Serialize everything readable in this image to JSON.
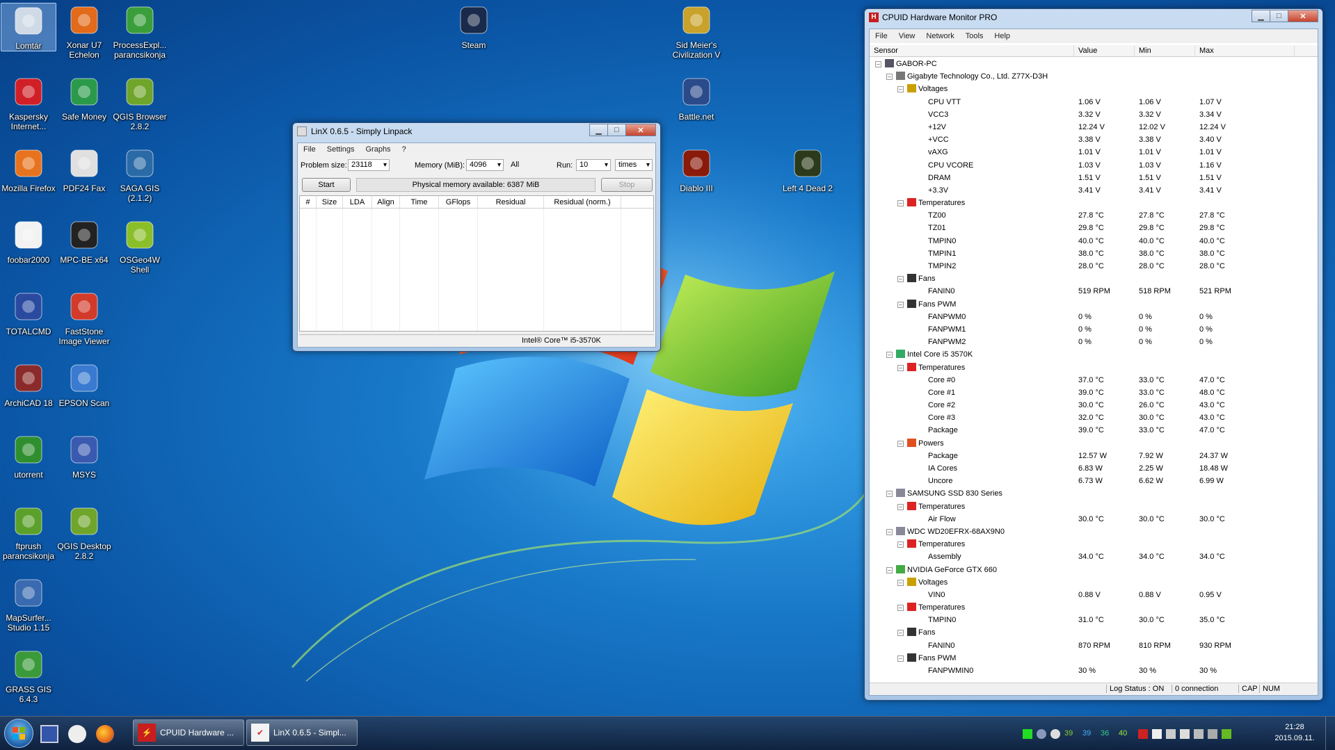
{
  "desktop_icons": [
    {
      "label": "Lomtár",
      "icon": "recycle-bin-icon"
    },
    {
      "label": "Xonar U7 Echelon",
      "icon": "equalizer-icon"
    },
    {
      "label": "ProcessExpl... parancsikonja",
      "icon": "process-explorer-icon"
    },
    {
      "label": "Kaspersky Internet...",
      "icon": "kaspersky-icon"
    },
    {
      "label": "Safe Money",
      "icon": "safe-money-icon"
    },
    {
      "label": "QGIS Browser 2.8.2",
      "icon": "qgis-icon"
    },
    {
      "label": "Mozilla Firefox",
      "icon": "firefox-icon"
    },
    {
      "label": "PDF24 Fax",
      "icon": "pdf24-icon"
    },
    {
      "label": "SAGA GIS (2.1.2)",
      "icon": "saga-gis-icon"
    },
    {
      "label": "foobar2000",
      "icon": "foobar-icon"
    },
    {
      "label": "MPC-BE x64",
      "icon": "mpc-be-icon"
    },
    {
      "label": "OSGeo4W Shell",
      "icon": "osgeo-icon"
    },
    {
      "label": "TOTALCMD",
      "icon": "floppy-icon"
    },
    {
      "label": "FastStone Image Viewer",
      "icon": "faststone-icon"
    },
    {
      "label": "ArchiCAD 18",
      "icon": "archicad-icon"
    },
    {
      "label": "EPSON Scan",
      "icon": "scanner-icon"
    },
    {
      "label": "utorrent",
      "icon": "utorrent-icon"
    },
    {
      "label": "MSYS",
      "icon": "msys-icon"
    },
    {
      "label": "ftprush parancsikonja",
      "icon": "ftprush-icon"
    },
    {
      "label": "QGIS Desktop 2.8.2",
      "icon": "qgis-desktop-icon"
    },
    {
      "label": "MapSurfer... Studio 1.15",
      "icon": "mapsurfer-icon"
    },
    {
      "label": "GRASS GIS 6.4.3",
      "icon": "grass-icon"
    },
    {
      "label": "Steam",
      "icon": "steam-icon"
    },
    {
      "label": "Sid Meier's Civilization V",
      "icon": "civilization-icon"
    },
    {
      "label": "Battle.net",
      "icon": "battlenet-icon"
    },
    {
      "label": "Diablo III",
      "icon": "diablo-icon"
    },
    {
      "label": "Left 4 Dead 2",
      "icon": "left4dead-icon"
    }
  ],
  "linx": {
    "title": "LinX 0.6.5 - Simply Linpack",
    "menu": [
      "File",
      "Settings",
      "Graphs",
      "?"
    ],
    "problem_size_label": "Problem size:",
    "problem_size": "23118",
    "memory_label": "Memory (MiB):",
    "memory": "4096",
    "all_label": "All",
    "run_label": "Run:",
    "run": "10",
    "run_unit": "times",
    "start": "Start",
    "phys_mem": "Physical memory available: 6387 MiB",
    "stop": "Stop",
    "columns": [
      "#",
      "Size",
      "LDA",
      "Align",
      "Time",
      "GFlops",
      "Residual",
      "Residual (norm.)"
    ],
    "status_cpu": "Intel® Core™ i5-3570K"
  },
  "hwmon": {
    "title": "CPUID Hardware Monitor PRO",
    "menu": [
      "File",
      "View",
      "Network",
      "Tools",
      "Help"
    ],
    "columns": [
      "Sensor",
      "Value",
      "Min",
      "Max"
    ],
    "rows": [
      {
        "level": 0,
        "name": "GABOR-PC",
        "type": "computer"
      },
      {
        "level": 1,
        "name": "Gigabyte Technology Co., Ltd. Z77X-D3H",
        "type": "board"
      },
      {
        "level": 2,
        "name": "Voltages",
        "type": "voltage"
      },
      {
        "level": 3,
        "name": "CPU VTT",
        "v": "1.06 V",
        "min": "1.06 V",
        "max": "1.07 V"
      },
      {
        "level": 3,
        "name": "VCC3",
        "v": "3.32 V",
        "min": "3.32 V",
        "max": "3.34 V"
      },
      {
        "level": 3,
        "name": "+12V",
        "v": "12.24 V",
        "min": "12.02 V",
        "max": "12.24 V"
      },
      {
        "level": 3,
        "name": "+VCC",
        "v": "3.38 V",
        "min": "3.38 V",
        "max": "3.40 V"
      },
      {
        "level": 3,
        "name": "vAXG",
        "v": "1.01 V",
        "min": "1.01 V",
        "max": "1.01 V"
      },
      {
        "level": 3,
        "name": "CPU VCORE",
        "v": "1.03 V",
        "min": "1.03 V",
        "max": "1.16 V"
      },
      {
        "level": 3,
        "name": "DRAM",
        "v": "1.51 V",
        "min": "1.51 V",
        "max": "1.51 V"
      },
      {
        "level": 3,
        "name": "+3.3V",
        "v": "3.41 V",
        "min": "3.41 V",
        "max": "3.41 V"
      },
      {
        "level": 2,
        "name": "Temperatures",
        "type": "temp"
      },
      {
        "level": 3,
        "name": "TZ00",
        "v": "27.8 °C",
        "min": "27.8 °C",
        "max": "27.8 °C"
      },
      {
        "level": 3,
        "name": "TZ01",
        "v": "29.8 °C",
        "min": "29.8 °C",
        "max": "29.8 °C"
      },
      {
        "level": 3,
        "name": "TMPIN0",
        "v": "40.0 °C",
        "min": "40.0 °C",
        "max": "40.0 °C"
      },
      {
        "level": 3,
        "name": "TMPIN1",
        "v": "38.0 °C",
        "min": "38.0 °C",
        "max": "38.0 °C"
      },
      {
        "level": 3,
        "name": "TMPIN2",
        "v": "28.0 °C",
        "min": "28.0 °C",
        "max": "28.0 °C"
      },
      {
        "level": 2,
        "name": "Fans",
        "type": "fan"
      },
      {
        "level": 3,
        "name": "FANIN0",
        "v": "519 RPM",
        "min": "518 RPM",
        "max": "521 RPM"
      },
      {
        "level": 2,
        "name": "Fans PWM",
        "type": "fan"
      },
      {
        "level": 3,
        "name": "FANPWM0",
        "v": "0 %",
        "min": "0 %",
        "max": "0 %"
      },
      {
        "level": 3,
        "name": "FANPWM1",
        "v": "0 %",
        "min": "0 %",
        "max": "0 %"
      },
      {
        "level": 3,
        "name": "FANPWM2",
        "v": "0 %",
        "min": "0 %",
        "max": "0 %"
      },
      {
        "level": 1,
        "name": "Intel Core i5 3570K",
        "type": "cpu"
      },
      {
        "level": 2,
        "name": "Temperatures",
        "type": "temp"
      },
      {
        "level": 3,
        "name": "Core #0",
        "v": "37.0 °C",
        "min": "33.0 °C",
        "max": "47.0 °C"
      },
      {
        "level": 3,
        "name": "Core #1",
        "v": "39.0 °C",
        "min": "33.0 °C",
        "max": "48.0 °C"
      },
      {
        "level": 3,
        "name": "Core #2",
        "v": "30.0 °C",
        "min": "26.0 °C",
        "max": "43.0 °C"
      },
      {
        "level": 3,
        "name": "Core #3",
        "v": "32.0 °C",
        "min": "30.0 °C",
        "max": "43.0 °C"
      },
      {
        "level": 3,
        "name": "Package",
        "v": "39.0 °C",
        "min": "33.0 °C",
        "max": "47.0 °C"
      },
      {
        "level": 2,
        "name": "Powers",
        "type": "power"
      },
      {
        "level": 3,
        "name": "Package",
        "v": "12.57 W",
        "min": "7.92 W",
        "max": "24.37 W"
      },
      {
        "level": 3,
        "name": "IA Cores",
        "v": "6.83 W",
        "min": "2.25 W",
        "max": "18.48 W"
      },
      {
        "level": 3,
        "name": "Uncore",
        "v": "6.73 W",
        "min": "6.62 W",
        "max": "6.99 W"
      },
      {
        "level": 1,
        "name": "SAMSUNG SSD 830 Series",
        "type": "disk"
      },
      {
        "level": 2,
        "name": "Temperatures",
        "type": "temp"
      },
      {
        "level": 3,
        "name": "Air Flow",
        "v": "30.0 °C",
        "min": "30.0 °C",
        "max": "30.0 °C"
      },
      {
        "level": 1,
        "name": "WDC WD20EFRX-68AX9N0",
        "type": "disk"
      },
      {
        "level": 2,
        "name": "Temperatures",
        "type": "temp"
      },
      {
        "level": 3,
        "name": "Assembly",
        "v": "34.0 °C",
        "min": "34.0 °C",
        "max": "34.0 °C"
      },
      {
        "level": 1,
        "name": "NVIDIA GeForce GTX 660",
        "type": "gpu"
      },
      {
        "level": 2,
        "name": "Voltages",
        "type": "voltage"
      },
      {
        "level": 3,
        "name": "VIN0",
        "v": "0.88 V",
        "min": "0.88 V",
        "max": "0.95 V"
      },
      {
        "level": 2,
        "name": "Temperatures",
        "type": "temp"
      },
      {
        "level": 3,
        "name": "TMPIN0",
        "v": "31.0 °C",
        "min": "30.0 °C",
        "max": "35.0 °C"
      },
      {
        "level": 2,
        "name": "Fans",
        "type": "fan"
      },
      {
        "level": 3,
        "name": "FANIN0",
        "v": "870 RPM",
        "min": "810 RPM",
        "max": "930 RPM"
      },
      {
        "level": 2,
        "name": "Fans PWM",
        "type": "fan"
      },
      {
        "level": 3,
        "name": "FANPWMIN0",
        "v": "30 %",
        "min": "30 %",
        "max": "30 %"
      }
    ],
    "status": {
      "log": "Log Status : ON",
      "conn": "0 connection",
      "cap": "CAP",
      "num": "NUM"
    }
  },
  "taskbar": {
    "items": [
      {
        "label": "CPUID Hardware ..."
      },
      {
        "label": "LinX 0.6.5 - Simpl..."
      }
    ],
    "tray_numbers": [
      "39",
      "39",
      "36",
      "40"
    ],
    "time": "21:28",
    "date": "2015.09.11."
  }
}
